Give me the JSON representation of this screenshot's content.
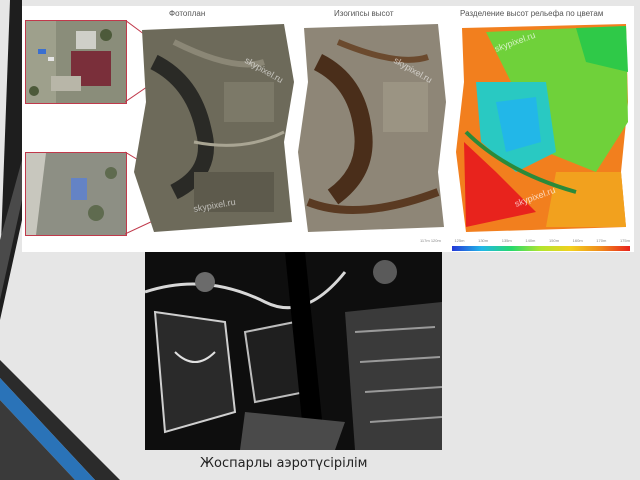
{
  "slide": {
    "panel_titles": {
      "photoplan": "Фотоплан",
      "contours": "Изогипсы высот",
      "relief": "Разделение высот рельефа по цветам"
    },
    "watermark": "skypixel.ru",
    "legend_ticks": [
      "117m 120m",
      "125m",
      "130m",
      "135m",
      "140m",
      "150m",
      "160m",
      "170m",
      "175m"
    ],
    "caption": "Жоспарлы аэротүсірілім"
  },
  "colors": {
    "accent_red": "#c0394b",
    "stripe_dark": "#222222",
    "stripe_blue": "#2a73b8",
    "background": "#e6e6e6"
  }
}
